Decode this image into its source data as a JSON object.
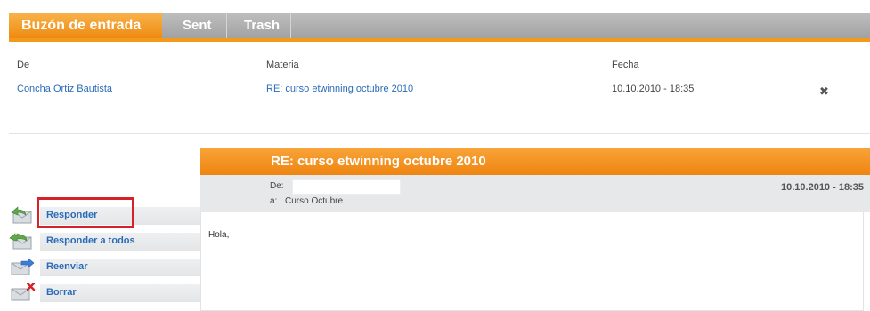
{
  "tabs": {
    "inbox": "Buzón de entrada",
    "sent": "Sent",
    "trash": "Trash"
  },
  "inbox": {
    "columns": {
      "from": "De",
      "subject": "Materia",
      "date": "Fecha"
    },
    "rows": [
      {
        "from": "Concha Ortiz Bautista",
        "subject": "RE: curso etwinning octubre 2010",
        "date": "10.10.2010 - 18:35",
        "delete_icon": "✖"
      }
    ]
  },
  "message": {
    "title": "RE: curso etwinning octubre 2010",
    "from_label": "De:",
    "to_label": "a:",
    "to_value": "Curso Octubre",
    "date": "10.10.2010 - 18:35",
    "body": "Hola,"
  },
  "actions": [
    {
      "label": "Responder",
      "icon": "reply-icon"
    },
    {
      "label": "Responder a todos",
      "icon": "reply-all-icon"
    },
    {
      "label": "Reenviar",
      "icon": "forward-icon"
    },
    {
      "label": "Borrar",
      "icon": "delete-mail-icon"
    }
  ],
  "colors": {
    "accent": "#ef8a10",
    "link": "#2a6bb8",
    "highlight": "#d6212b"
  }
}
